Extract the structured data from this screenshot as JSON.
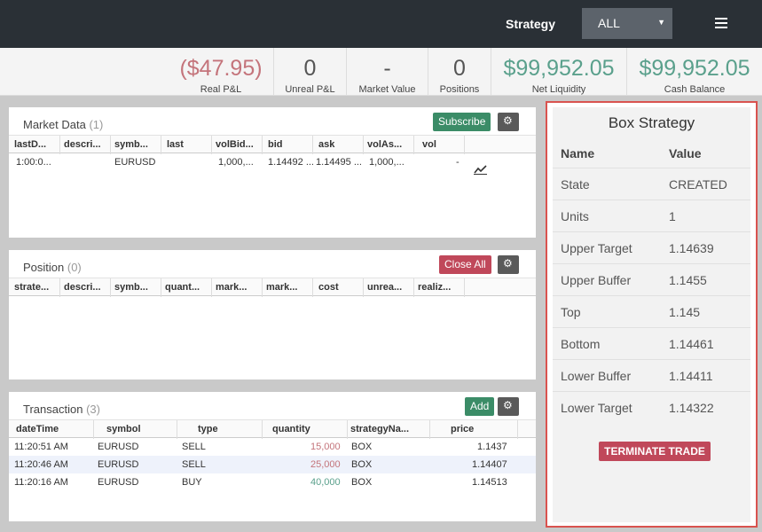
{
  "topbar": {
    "strategy_label": "Strategy",
    "strategy_selected": "ALL",
    "menu_icon": "hamburger-menu-icon"
  },
  "stats": [
    {
      "value": "($47.95)",
      "label": "Real P&L",
      "tone": "neg"
    },
    {
      "value": "0",
      "label": "Unreal P&L",
      "tone": "neu"
    },
    {
      "value": "-",
      "label": "Market Value",
      "tone": "neu"
    },
    {
      "value": "0",
      "label": "Positions",
      "tone": "neu"
    },
    {
      "value": "$99,952.05",
      "label": "Net Liquidity",
      "tone": "pos"
    },
    {
      "value": "$99,952.05",
      "label": "Cash Balance",
      "tone": "pos"
    }
  ],
  "market_data": {
    "title": "Market Data",
    "count": "(1)",
    "subscribe_label": "Subscribe",
    "columns": [
      "lastD...",
      "descri...",
      "symb...",
      "last",
      "volBid...",
      "bid",
      "ask",
      "volAs...",
      "vol"
    ],
    "rows": [
      {
        "lastD": "1:00:0...",
        "descr": "",
        "symbol": "EURUSD",
        "last": "",
        "volBid": "1,000,...",
        "bid": "1.14492 ...",
        "ask": "1.14495 ...",
        "volAsk": "1,000,...",
        "vol": "-"
      }
    ]
  },
  "position": {
    "title": "Position",
    "count": "(0)",
    "close_all_label": "Close All",
    "columns": [
      "strate...",
      "descri...",
      "symb...",
      "quant...",
      "mark...",
      "mark...",
      "cost",
      "unrea...",
      "realiz..."
    ]
  },
  "transaction": {
    "title": "Transaction",
    "count": "(3)",
    "add_label": "Add",
    "columns": [
      "dateTime",
      "symbol",
      "type",
      "quantity",
      "strategyNa...",
      "price"
    ],
    "rows": [
      {
        "dateTime": "11:20:51 AM",
        "symbol": "EURUSD",
        "type": "SELL",
        "quantity": "15,000",
        "strategy": "BOX",
        "price": "1.1437",
        "qtone": "neg"
      },
      {
        "dateTime": "11:20:46 AM",
        "symbol": "EURUSD",
        "type": "SELL",
        "quantity": "25,000",
        "strategy": "BOX",
        "price": "1.14407",
        "qtone": "neg"
      },
      {
        "dateTime": "11:20:16 AM",
        "symbol": "EURUSD",
        "type": "BUY",
        "quantity": "40,000",
        "strategy": "BOX",
        "price": "1.14513",
        "qtone": "pos"
      }
    ]
  },
  "box": {
    "title": "Box Strategy",
    "name_header": "Name",
    "value_header": "Value",
    "rows": [
      {
        "name": "State",
        "value": "CREATED"
      },
      {
        "name": "Units",
        "value": "1"
      },
      {
        "name": "Upper Target",
        "value": "1.14639"
      },
      {
        "name": "Upper Buffer",
        "value": "1.1455"
      },
      {
        "name": "Top",
        "value": "1.145"
      },
      {
        "name": "Bottom",
        "value": "1.14461"
      },
      {
        "name": "Lower Buffer",
        "value": "1.14411"
      },
      {
        "name": "Lower Target",
        "value": "1.14322"
      }
    ],
    "terminate_label": "TERMINATE TRADE"
  },
  "colors": {
    "negative": "#c4747b",
    "positive": "#5aa08c",
    "accent_green": "#3b8c67",
    "accent_red": "#c0485a"
  }
}
